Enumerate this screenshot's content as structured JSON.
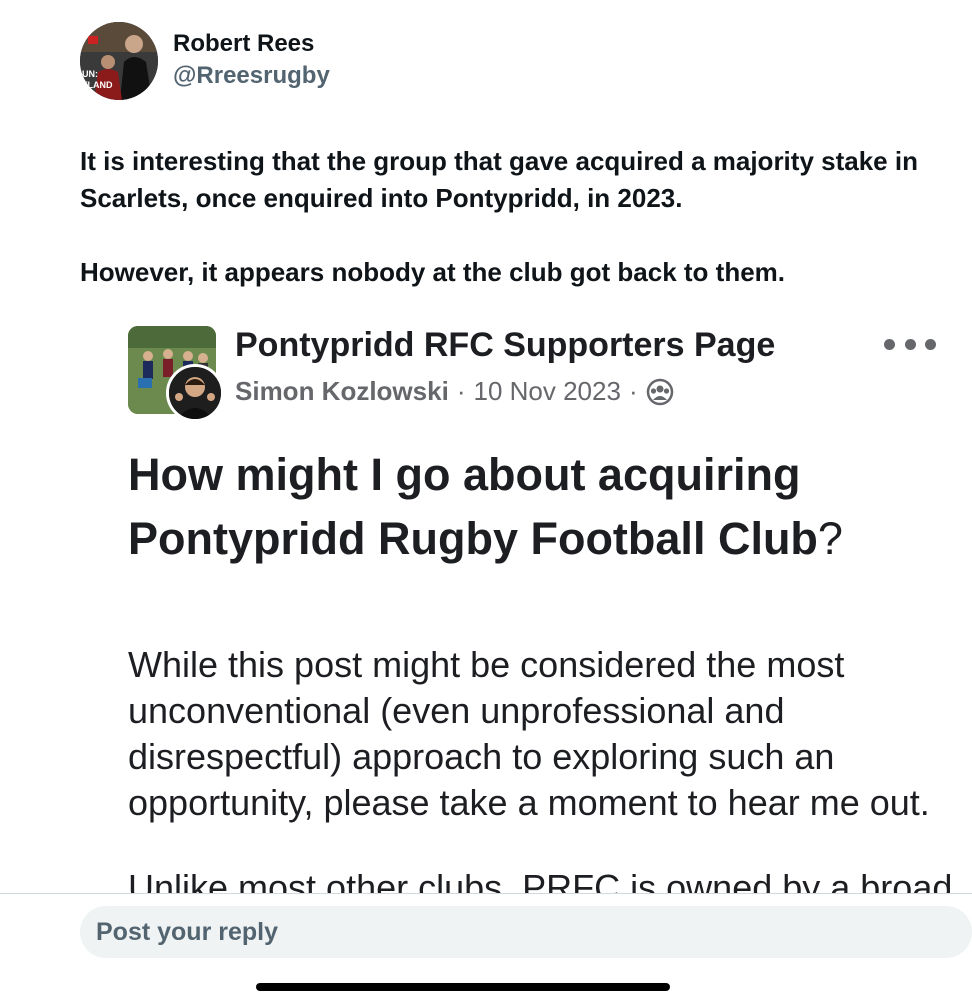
{
  "tweet": {
    "author_name": "Robert Rees",
    "author_handle": "@Rreesrugby",
    "avatar_text": "UN:\nTLAND",
    "paragraphs": [
      "It is interesting that the group that gave acquired a majority stake in Scarlets, once enquired into Pontypridd, in 2023.",
      "However, it appears nobody at the club got back to them."
    ]
  },
  "embedded_post": {
    "group_name": "Pontypridd RFC Supporters Page",
    "author": "Simon Kozlowski",
    "date": "10 Nov 2023",
    "separator": "·",
    "title_main": "How might I go about acquiring Pontypridd Rugby Football Club",
    "title_mark": "?",
    "body": "While this post might be considered the most unconventional (even unprofessional and disrespectful) approach to exploring such an opportunity, please take a moment to hear me out.",
    "body_cut": "Unlike most other clubs, PRFC is owned by a broad",
    "icons": {
      "audience": "group-audience-icon",
      "more": "more-options-icon"
    }
  },
  "reply": {
    "placeholder": "Post your reply"
  }
}
